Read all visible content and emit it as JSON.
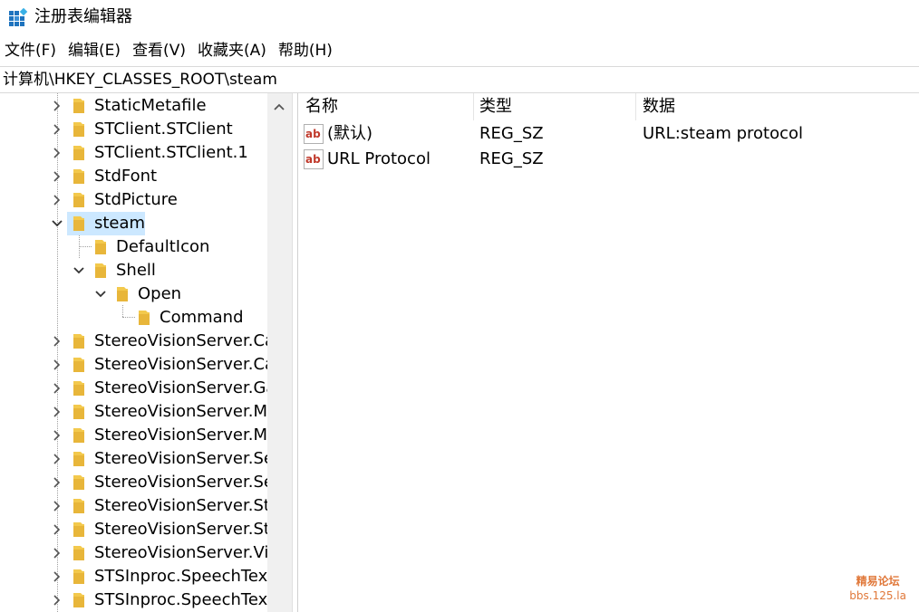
{
  "window": {
    "title": "注册表编辑器",
    "icon": "regedit-icon"
  },
  "menu": {
    "file": "文件(F)",
    "edit": "编辑(E)",
    "view": "查看(V)",
    "favorites": "收藏夹(A)",
    "help": "帮助(H)"
  },
  "address": {
    "path": "计算机\\HKEY_CLASSES_ROOT\\steam"
  },
  "tree": {
    "items": [
      {
        "label": "StaticMetafile",
        "state": "collapsed"
      },
      {
        "label": "STClient.STClient",
        "state": "collapsed"
      },
      {
        "label": "STClient.STClient.1",
        "state": "collapsed"
      },
      {
        "label": "StdFont",
        "state": "collapsed"
      },
      {
        "label": "StdPicture",
        "state": "collapsed"
      },
      {
        "label": "steam",
        "state": "expanded",
        "selected": true
      },
      {
        "label": "DefaultIcon",
        "state": "leaf"
      },
      {
        "label": "Shell",
        "state": "expanded"
      },
      {
        "label": "Open",
        "state": "expanded"
      },
      {
        "label": "Command",
        "state": "leaf"
      },
      {
        "label": "StereoVisionServer.Cat",
        "state": "collapsed"
      },
      {
        "label": "StereoVisionServer.Cat",
        "state": "collapsed"
      },
      {
        "label": "StereoVisionServer.Gar",
        "state": "collapsed"
      },
      {
        "label": "StereoVisionServer.Ma",
        "state": "collapsed"
      },
      {
        "label": "StereoVisionServer.Ma",
        "state": "collapsed"
      },
      {
        "label": "StereoVisionServer.Set",
        "state": "collapsed"
      },
      {
        "label": "StereoVisionServer.Set",
        "state": "collapsed"
      },
      {
        "label": "StereoVisionServer.Ste",
        "state": "collapsed"
      },
      {
        "label": "StereoVisionServer.Ste",
        "state": "collapsed"
      },
      {
        "label": "StereoVisionServer.Vid",
        "state": "collapsed"
      },
      {
        "label": "STSInproc.SpeechTextS",
        "state": "collapsed"
      },
      {
        "label": "STSInproc.SpeechTextS",
        "state": "collapsed"
      }
    ]
  },
  "list": {
    "columns": {
      "name": "名称",
      "type": "类型",
      "data": "数据"
    },
    "rows": [
      {
        "icon": "string-value-icon",
        "name": "(默认)",
        "type": "REG_SZ",
        "data": "URL:steam protocol"
      },
      {
        "icon": "string-value-icon",
        "name": "URL Protocol",
        "type": "REG_SZ",
        "data": ""
      }
    ]
  },
  "watermark": {
    "line1": "精易论坛",
    "line2": "bbs.125.la"
  },
  "colors": {
    "selection": "#cce8ff",
    "folder": "#f3c94d",
    "watermark": "#e0783a",
    "icon_red": "#c0392b"
  }
}
